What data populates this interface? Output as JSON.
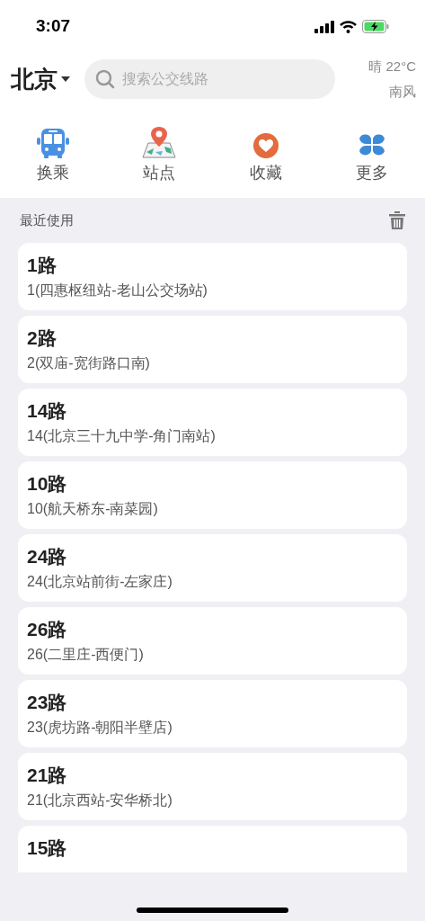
{
  "status_bar": {
    "time": "3:07"
  },
  "header": {
    "city": "北京",
    "search": {
      "placeholder": "搜索公交线路"
    },
    "weather": {
      "condition": "晴 22°C",
      "wind": "南风"
    }
  },
  "shortcuts": [
    {
      "kind": "bus",
      "label": "换乘"
    },
    {
      "kind": "stop",
      "label": "站点"
    },
    {
      "kind": "favorite",
      "label": "收藏"
    },
    {
      "kind": "more",
      "label": "更多"
    }
  ],
  "recent": {
    "title": "最近使用",
    "routes": [
      {
        "name": "1路",
        "detail": "1(四惠枢纽站-老山公交场站)"
      },
      {
        "name": "2路",
        "detail": "2(双庙-宽街路口南)"
      },
      {
        "name": "14路",
        "detail": "14(北京三十九中学-角门南站)"
      },
      {
        "name": "10路",
        "detail": "10(航天桥东-南菜园)"
      },
      {
        "name": "24路",
        "detail": "24(北京站前街-左家庄)"
      },
      {
        "name": "26路",
        "detail": "26(二里庄-西便门)"
      },
      {
        "name": "23路",
        "detail": "23(虎坊路-朝阳半壁店)"
      },
      {
        "name": "21路",
        "detail": "21(北京西站-安华桥北)"
      },
      {
        "name": "15路"
      }
    ]
  }
}
